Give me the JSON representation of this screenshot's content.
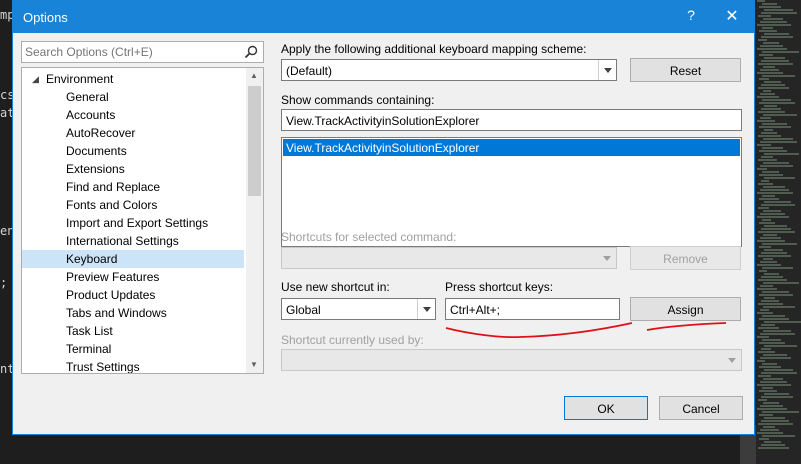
{
  "background": {
    "code_fragments": [
      "mp",
      "cs",
      "at",
      "en",
      ";",
      "nt"
    ]
  },
  "dialog": {
    "title": "Options",
    "help_glyph": "?",
    "close_glyph": "✕",
    "accent_color": "#1883d7"
  },
  "search": {
    "placeholder": "Search Options (Ctrl+E)",
    "icon": "search-icon"
  },
  "tree": {
    "root": "Environment",
    "items": [
      {
        "label": "General",
        "selected": false
      },
      {
        "label": "Accounts",
        "selected": false
      },
      {
        "label": "AutoRecover",
        "selected": false
      },
      {
        "label": "Documents",
        "selected": false
      },
      {
        "label": "Extensions",
        "selected": false
      },
      {
        "label": "Find and Replace",
        "selected": false
      },
      {
        "label": "Fonts and Colors",
        "selected": false
      },
      {
        "label": "Import and Export Settings",
        "selected": false
      },
      {
        "label": "International Settings",
        "selected": false
      },
      {
        "label": "Keyboard",
        "selected": true
      },
      {
        "label": "Preview Features",
        "selected": false
      },
      {
        "label": "Product Updates",
        "selected": false
      },
      {
        "label": "Tabs and Windows",
        "selected": false
      },
      {
        "label": "Task List",
        "selected": false
      },
      {
        "label": "Terminal",
        "selected": false
      },
      {
        "label": "Trust Settings",
        "selected": false
      }
    ]
  },
  "keyboard": {
    "mapping_label": "Apply the following additional keyboard mapping scheme:",
    "mapping_value": "(Default)",
    "reset_label": "Reset",
    "show_commands_label": "Show commands containing:",
    "show_commands_value": "View.TrackActivityinSolutionExplorer",
    "commands": [
      "View.TrackActivityinSolutionExplorer"
    ],
    "shortcuts_label": "Shortcuts for selected command:",
    "remove_label": "Remove",
    "use_new_label": "Use new shortcut in:",
    "use_new_value": "Global",
    "press_keys_label": "Press shortcut keys:",
    "press_keys_value": "Ctrl+Alt+;",
    "assign_label": "Assign",
    "currently_used_label": "Shortcut currently used by:"
  },
  "footer": {
    "ok_label": "OK",
    "cancel_label": "Cancel"
  },
  "annotation_color": "#e0101a"
}
